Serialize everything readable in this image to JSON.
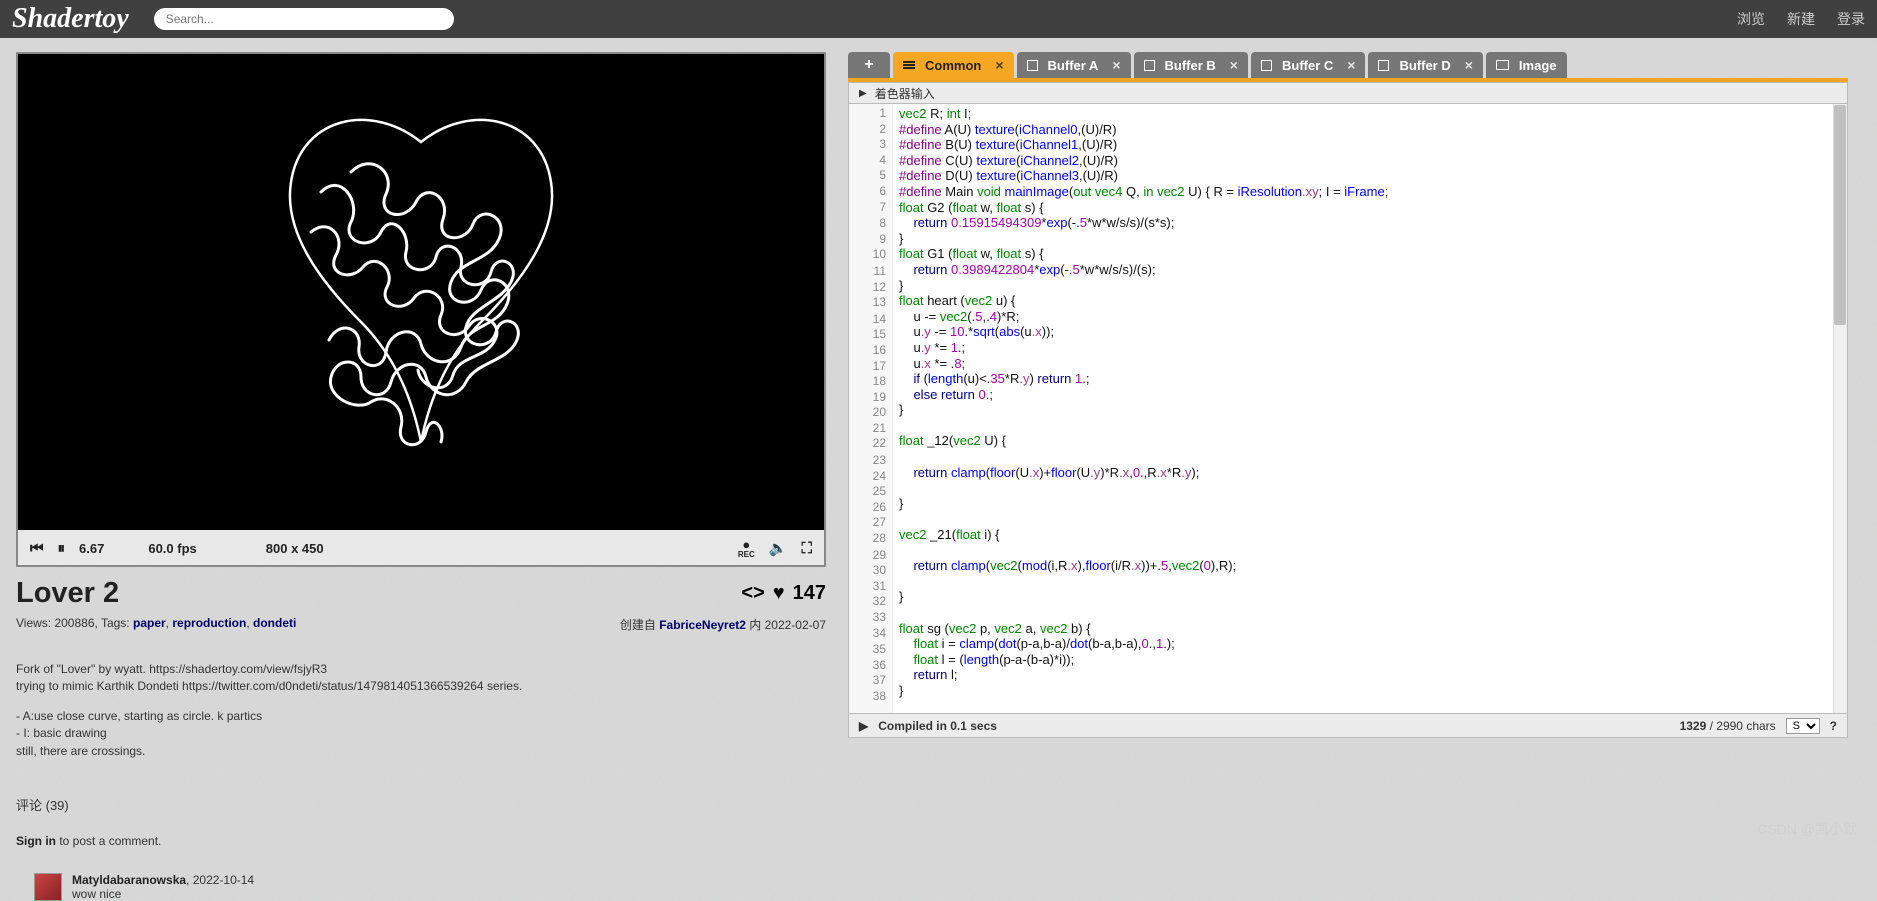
{
  "header": {
    "logo": "Shadertoy",
    "search_placeholder": "Search...",
    "nav": {
      "browse": "浏览",
      "new": "新建",
      "login": "登录"
    }
  },
  "player": {
    "time": "6.67",
    "fps": "60.0 fps",
    "res": "800 x 450",
    "rec": "REC"
  },
  "shader": {
    "title": "Lover 2",
    "likes": "147",
    "views_tags_prefix": "Views: 200886, Tags: ",
    "tags": [
      "paper",
      "reproduction",
      "dondeti"
    ],
    "created_prefix": "创建自 ",
    "author": "FabriceNeyret2",
    "created_suffix": " 内 2022-02-07",
    "desc_l1": "Fork of \"Lover\" by wyatt. https://shadertoy.com/view/fsjyR3",
    "desc_l2": "trying to mimic Karthik Dondeti https://twitter.com/d0ndeti/status/1479814051366539264 series.",
    "desc_l3": "- A:use close curve, starting as circle. k partics",
    "desc_l4": "- I: basic drawing",
    "desc_l5": "still, there are crossings."
  },
  "comments": {
    "heading": "评论 (39)",
    "signin": "Sign in",
    "signin_suffix": " to post a comment.",
    "c1_user": "Matyldabaranowska",
    "c1_date": ", 2022-10-14",
    "c1_text": "wow  nice"
  },
  "tabs": {
    "common": "Common",
    "ba": "Buffer A",
    "bb": "Buffer B",
    "bc": "Buffer C",
    "bd": "Buffer D",
    "image": "Image"
  },
  "inputs_label": "着色器输入",
  "code_lines": {
    "l1": "vec2 R; int I;",
    "l2": "#define A(U) texture(iChannel0,(U)/R)",
    "l3": "#define B(U) texture(iChannel1,(U)/R)",
    "l4": "#define C(U) texture(iChannel2,(U)/R)",
    "l5": "#define D(U) texture(iChannel3,(U)/R)",
    "l6": "#define Main void mainImage(out vec4 Q, in vec2 U) { R = iResolution.xy; I = iFrame;",
    "l7": "float G2 (float w, float s) {",
    "l8": "    return 0.15915494309*exp(-.5*w*w/s/s)/(s*s);",
    "l9": "}",
    "l10": "float G1 (float w, float s) {",
    "l11": "    return 0.3989422804*exp(-.5*w*w/s/s)/(s);",
    "l12": "}",
    "l13": "float heart (vec2 u) {",
    "l14": "    u -= vec2(.5,.4)*R;",
    "l15": "    u.y -= 10.*sqrt(abs(u.x));",
    "l16": "    u.y *= 1.;",
    "l17": "    u.x *= .8;",
    "l18": "    if (length(u)<.35*R.y) return 1.;",
    "l19": "    else return 0.;",
    "l20": "}",
    "l21": "",
    "l22": "float _12(vec2 U) {",
    "l23": "",
    "l24": "    return clamp(floor(U.x)+floor(U.y)*R.x,0.,R.x*R.y);",
    "l25": "",
    "l26": "}",
    "l27": "",
    "l28": "vec2 _21(float i) {",
    "l29": "",
    "l30": "    return clamp(vec2(mod(i,R.x),floor(i/R.x))+.5,vec2(0),R);",
    "l31": "",
    "l32": "}",
    "l33": "",
    "l34": "float sg (vec2 p, vec2 a, vec2 b) {",
    "l35": "    float i = clamp(dot(p-a,b-a)/dot(b-a,b-a),0.,1.);",
    "l36": "    float l = (length(p-a-(b-a)*i));",
    "l37": "    return l;",
    "l38": "}"
  },
  "status": {
    "compiled": "Compiled in 0.1 secs",
    "cursor": "1329",
    "chars_suffix": " / 2990 chars",
    "size_sel": "S",
    "help": "?"
  },
  "watermark": "CSDN @凯小默"
}
